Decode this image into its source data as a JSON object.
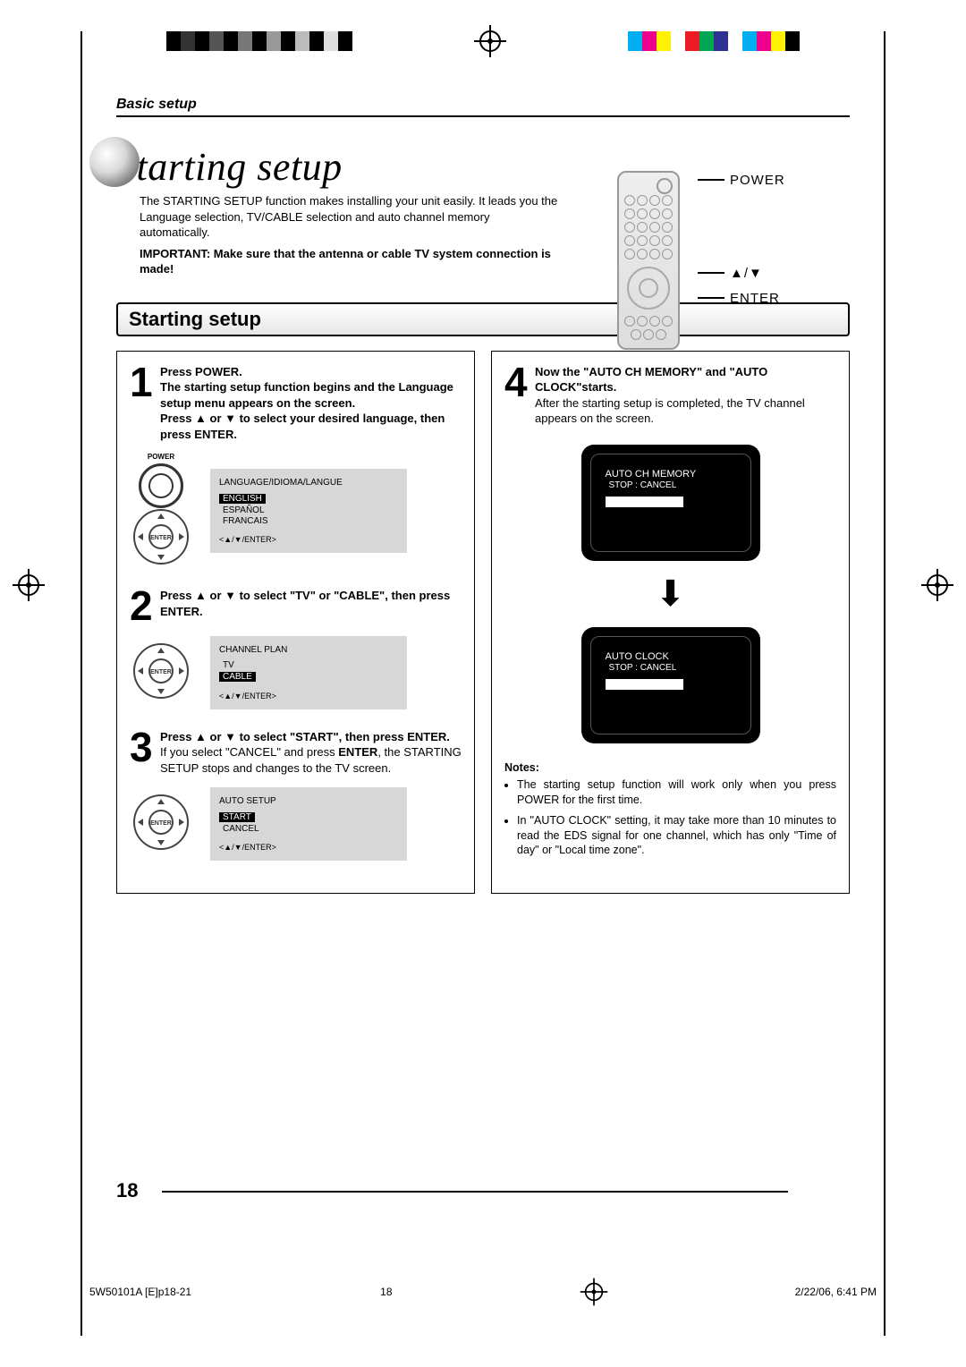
{
  "header": {
    "breadcrumb": "Basic setup"
  },
  "hero": {
    "title": "Starting setup",
    "intro": "The STARTING SETUP function makes installing your unit easily. It leads you the Language selection, TV/CABLE selection and auto channel memory automatically.",
    "important": "IMPORTANT: Make sure that the antenna or cable TV system connection is made!"
  },
  "remote": {
    "label_power": "POWER",
    "label_nav": "▲/▼",
    "label_enter": "ENTER"
  },
  "section_title": "Starting setup",
  "steps": {
    "s1": {
      "b1": "Press POWER.",
      "b2": "The starting setup function begins and the Language setup menu appears on the screen.",
      "b3": "Press ▲ or ▼ to select your desired language, then press ENTER."
    },
    "s2": {
      "b1": "Press ▲ or ▼ to select \"TV\" or \"CABLE\", then press ENTER."
    },
    "s3": {
      "b1": "Press ▲ or ▼ to select \"START\", then press ENTER.",
      "body_pre": "If you select \"CANCEL\" and press ",
      "body_bold": "ENTER",
      "body_post": ", the STARTING SETUP stops and changes to the TV screen."
    },
    "s4": {
      "b1": "Now the \"AUTO CH MEMORY\" and \"AUTO CLOCK\"starts.",
      "body": "After the starting setup is completed, the TV channel appears on the screen."
    }
  },
  "osd": {
    "lang_title": "LANGUAGE/IDIOMA/LANGUE",
    "lang_items": [
      "ENGLISH",
      "ESPAÑOL",
      "FRANCAIS"
    ],
    "plan_title": "CHANNEL PLAN",
    "plan_items": [
      "TV",
      "CABLE"
    ],
    "auto_title": "AUTO SETUP",
    "auto_items": [
      "START",
      "CANCEL"
    ],
    "nav_hint": "<▲/▼/ENTER>",
    "tv1_title": "AUTO CH MEMORY",
    "tv1_sub": "STOP : CANCEL",
    "tv2_title": "AUTO CLOCK",
    "tv2_sub": "STOP : CANCEL"
  },
  "notes": {
    "title": "Notes:",
    "items": [
      "The starting setup function will work only when you press POWER for the first time.",
      "In \"AUTO CLOCK\" setting, it may take more than 10 minutes to read the EDS signal for one channel, which has only \"Time of day\" or \"Local time zone\"."
    ]
  },
  "footer": {
    "page": "18",
    "doc_id": "5W50101A [E]p18-21",
    "page_small": "18",
    "date": "2/22/06, 6:41 PM"
  },
  "pwr_label": "POWER",
  "enter_label": "ENTER"
}
